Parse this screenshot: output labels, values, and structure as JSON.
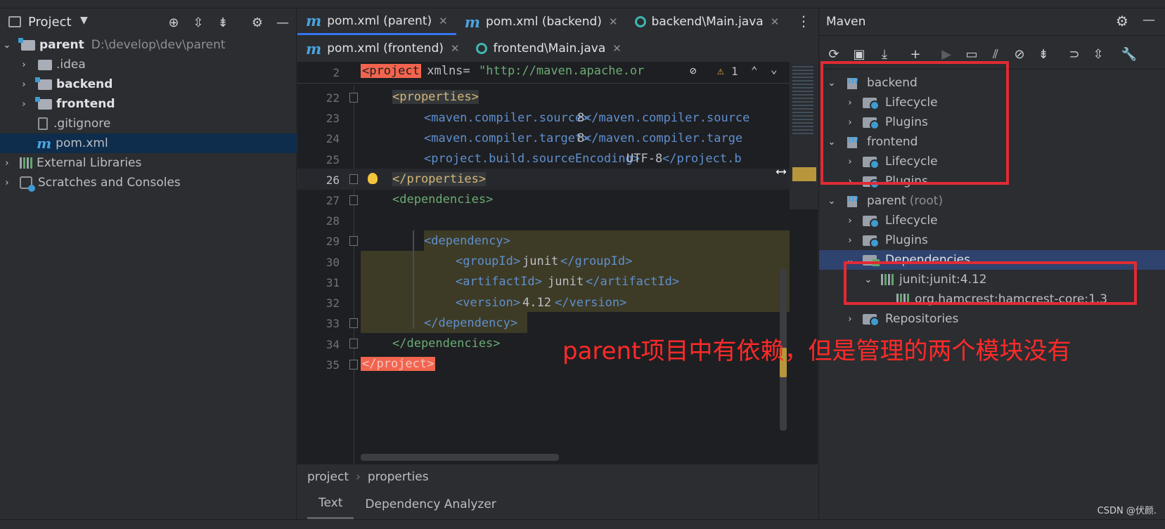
{
  "project_panel": {
    "title": "Project",
    "tree": [
      {
        "label": "parent",
        "path": "D:\\develop\\dev\\parent"
      },
      {
        "label": ".idea"
      },
      {
        "label": "backend"
      },
      {
        "label": "frontend"
      },
      {
        "label": ".gitignore"
      },
      {
        "label": "pom.xml"
      },
      {
        "label": "External Libraries"
      },
      {
        "label": "Scratches and Consoles"
      }
    ]
  },
  "editor": {
    "tabs_row1": [
      {
        "label": "pom.xml (parent)",
        "icon": "maven-file-icon"
      },
      {
        "label": "pom.xml (backend)",
        "icon": "maven-file-icon"
      },
      {
        "label": "backend\\Main.java",
        "icon": "java-class-icon"
      }
    ],
    "tabs_row2": [
      {
        "label": "pom.xml (frontend)",
        "icon": "maven-file-icon"
      },
      {
        "label": "frontend\\Main.java",
        "icon": "java-class-icon"
      }
    ],
    "sticky": {
      "line": "2",
      "tag": "<project",
      "attr": " xmlns=",
      "value": "\"http://maven.apache.org/P("
    },
    "warnings": "1",
    "lines": [
      {
        "n": "22",
        "code": "<properties>"
      },
      {
        "n": "23",
        "open": "<maven.compiler.source>",
        "text": "8",
        "close": "</maven.compiler.source"
      },
      {
        "n": "24",
        "open": "<maven.compiler.target>",
        "text": "8",
        "close": "</maven.compiler.targe"
      },
      {
        "n": "25",
        "open": "<project.build.sourceEncoding>",
        "text": "UTF-8",
        "close": "</project.b"
      },
      {
        "n": "26",
        "code": "</properties>"
      },
      {
        "n": "27",
        "code": "<dependencies>"
      },
      {
        "n": "28",
        "code": ""
      },
      {
        "n": "29",
        "code": "<dependency>"
      },
      {
        "n": "30",
        "open": "<groupId>",
        "text": "junit",
        "close": "</groupId>"
      },
      {
        "n": "31",
        "open": "<artifactId>",
        "text": "junit",
        "close": "</artifactId>"
      },
      {
        "n": "32",
        "open": "<version>",
        "text": "4.12",
        "close": "</version>"
      },
      {
        "n": "33",
        "code": "</dependency>"
      },
      {
        "n": "34",
        "code": "</dependencies>"
      },
      {
        "n": "35",
        "code": "</project>"
      }
    ],
    "breadcrumb": [
      "project",
      "properties"
    ],
    "bottom_tabs": [
      "Text",
      "Dependency Analyzer"
    ]
  },
  "maven": {
    "title": "Maven",
    "tree": [
      {
        "label": "backend"
      },
      {
        "label": "Lifecycle"
      },
      {
        "label": "Plugins"
      },
      {
        "label": "frontend"
      },
      {
        "label": "Lifecycle"
      },
      {
        "label": "Plugins"
      },
      {
        "label": "parent",
        "suffix": "(root)"
      },
      {
        "label": "Lifecycle"
      },
      {
        "label": "Plugins"
      },
      {
        "label": "Dependencies"
      },
      {
        "label": "junit:junit:4.12"
      },
      {
        "label": "org.hamcrest:hamcrest-core:1.3"
      },
      {
        "label": "Repositories"
      }
    ]
  },
  "annotation": "parent项目中有依赖，但是管理的两个模块没有",
  "watermark": "CSDN @伏颜."
}
